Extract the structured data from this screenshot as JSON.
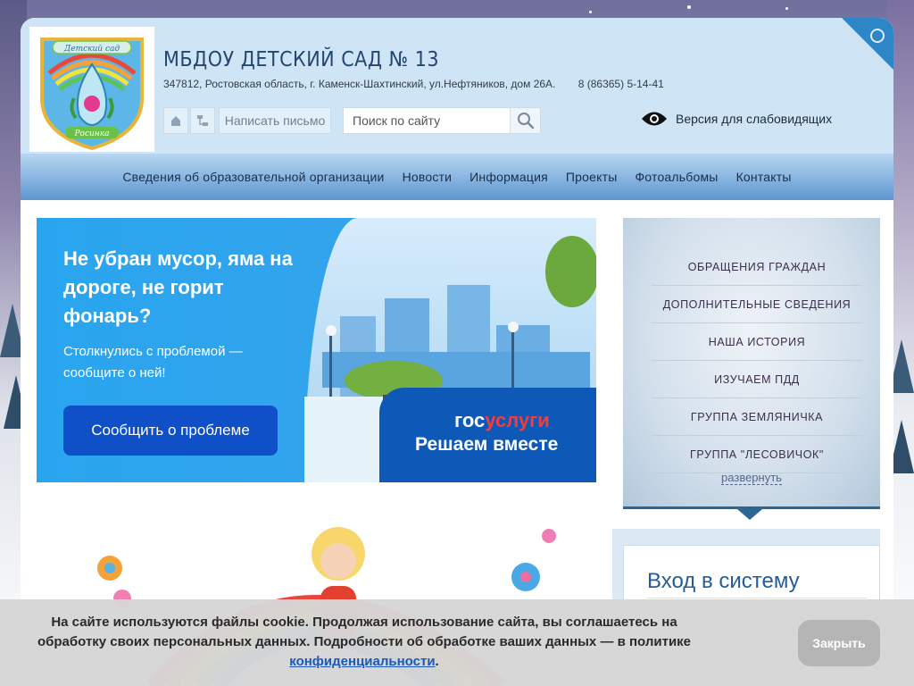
{
  "header": {
    "title": "МБДОУ ДЕТСКИЙ САД № 13",
    "address": "347812, Ростовская область, г. Каменск-Шахтинский, ул.Нефтяников, дом 26А.",
    "phone": "8 (86365) 5-14-41",
    "logo_text_top": "Детский сад",
    "logo_text_bottom": "Росинка",
    "write_letter": "Написать письмо",
    "search_placeholder": "Поиск по сайту",
    "low_vision": "Версия для слабовидящих"
  },
  "nav": {
    "items": [
      "Сведения об образовательной организации",
      "Новости",
      "Информация",
      "Проекты",
      "Фотоальбомы",
      "Контакты"
    ]
  },
  "banner": {
    "headline": "Не убран мусор, яма на дороге, не горит фонарь?",
    "subtext": "Столкнулись с проблемой — сообщите о ней!",
    "button": "Сообщить о проблеме",
    "brand_gos": "гос",
    "brand_uslugi": "услуги",
    "tagline": "Решаем вместе"
  },
  "side_menu": {
    "items": [
      "ОБРАЩЕНИЯ ГРАЖДАН",
      "ДОПОЛНИТЕЛЬНЫЕ СВЕДЕНИЯ",
      "НАША ИСТОРИЯ",
      "ИЗУЧАЕМ ПДД",
      "ГРУППА ЗЕМЛЯНИЧКА",
      "ГРУППА \"ЛЕСОВИЧОК\""
    ],
    "expand": "развернуть"
  },
  "login": {
    "title": "Вход в систему"
  },
  "cookie": {
    "text_line1": "На сайте используются файлы cookie. Продолжая использование сайта, вы соглашаетесь на обработку своих персональных данных. Подробности об обработке ваших данных — в политике ",
    "link": "конфиденциальности",
    "text_end": ".",
    "close": "Закрыть"
  },
  "colors": {
    "header_bg": "#cfe5f6",
    "title": "#23466e",
    "nav_bottom": "#5e95cf",
    "banner_blue": "#29a5ef",
    "gos_blue": "#0e59b7",
    "gos_red": "#ef3e42",
    "login_title": "#245d97"
  }
}
